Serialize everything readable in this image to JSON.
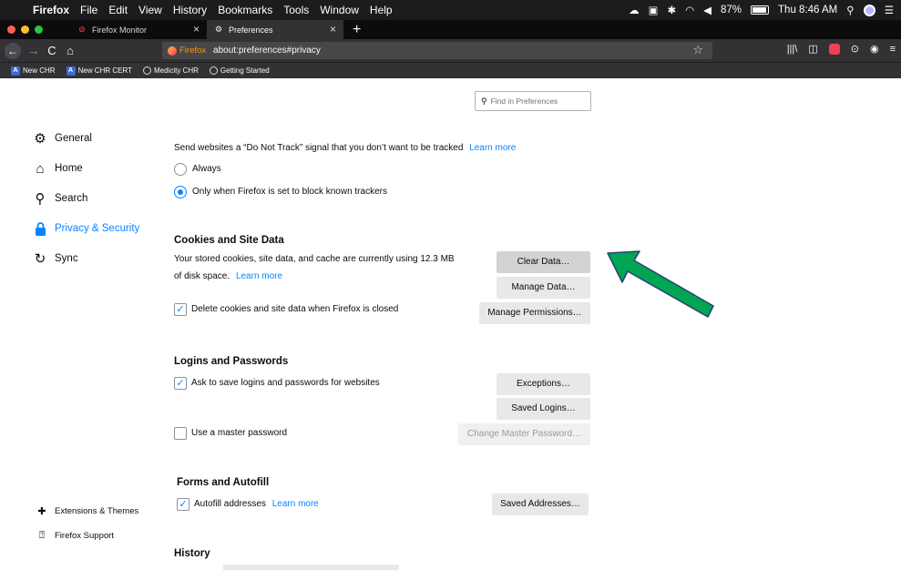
{
  "menubar": {
    "app": "Firefox",
    "items": [
      "File",
      "Edit",
      "View",
      "History",
      "Bookmarks",
      "Tools",
      "Window",
      "Help"
    ],
    "battery": "87%",
    "clock": "Thu 8:46 AM"
  },
  "tabs": [
    {
      "title": "Firefox Monitor",
      "close": "×"
    },
    {
      "title": "Preferences",
      "close": "×"
    }
  ],
  "newtab": "+",
  "nav": {
    "back": "←",
    "forward": "→",
    "reload": "C",
    "home": "⌂",
    "identity": "Firefox",
    "url": "about:preferences#privacy",
    "star": "☆",
    "library": "|||\\",
    "sidebar": "◫",
    "pocket": "",
    "account": "⊙",
    "menu": "≡"
  },
  "bookmarks": [
    {
      "label": "New CHR",
      "icon": "A"
    },
    {
      "label": "New CHR CERT",
      "icon": "A"
    },
    {
      "label": "Medicity CHR",
      "icon": "globe"
    },
    {
      "label": "Getting Started",
      "icon": "globe"
    }
  ],
  "find": {
    "placeholder": "Find in Preferences"
  },
  "sidebar": {
    "items": [
      {
        "label": "General",
        "icon": "gear"
      },
      {
        "label": "Home",
        "icon": "home"
      },
      {
        "label": "Search",
        "icon": "search"
      },
      {
        "label": "Privacy & Security",
        "icon": "lock"
      },
      {
        "label": "Sync",
        "icon": "sync"
      }
    ],
    "footer": [
      {
        "label": "Extensions & Themes",
        "icon": "puzzle"
      },
      {
        "label": "Firefox Support",
        "icon": "help"
      }
    ]
  },
  "dnt": {
    "text": "Send websites a “Do Not Track” signal that you don’t want to be tracked",
    "learn_more": "Learn more",
    "always": "Always",
    "only_when": "Only when Firefox is set to block known trackers"
  },
  "cookies": {
    "heading": "Cookies and Site Data",
    "line1": "Your stored cookies, site data, and cache are currently using 12.3 MB",
    "line2": "of disk space.",
    "learn_more": "Learn more",
    "delete_label": "Delete cookies and site data when Firefox is closed",
    "clear_data": "Clear Data…",
    "manage_data": "Manage Data…",
    "manage_permissions": "Manage Permissions…"
  },
  "logins": {
    "heading": "Logins and Passwords",
    "ask_label": "Ask to save logins and passwords for websites",
    "exceptions": "Exceptions…",
    "saved_logins": "Saved Logins…",
    "master_label": "Use a master password",
    "change_master": "Change Master Password…"
  },
  "forms": {
    "heading": "Forms and Autofill",
    "autofill_label": "Autofill addresses",
    "learn_more": "Learn more",
    "saved_addresses": "Saved Addresses…"
  },
  "history": {
    "heading": "History"
  },
  "colors": {
    "accent": "#0a84ff",
    "arrow": "#00a651"
  }
}
